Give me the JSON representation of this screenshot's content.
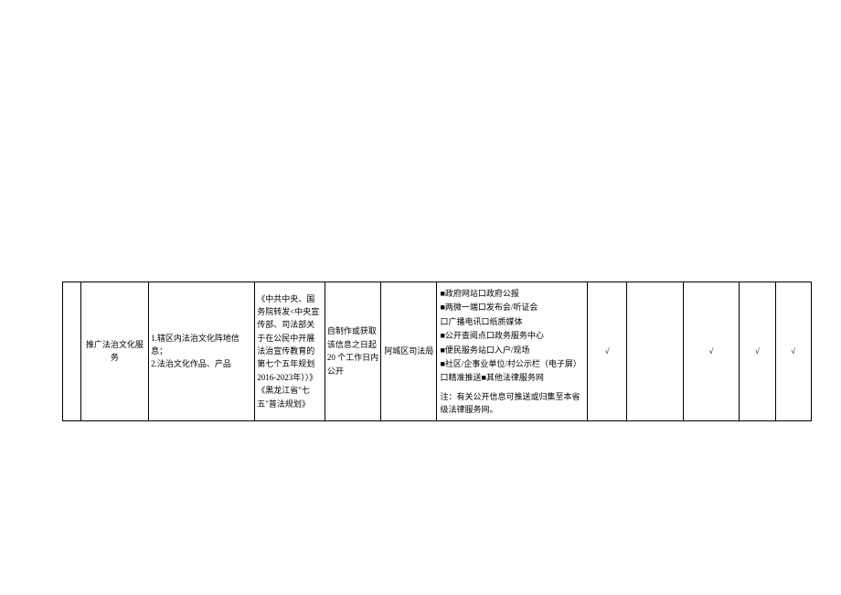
{
  "row": {
    "col0": "",
    "col1": "推广法治文化服务",
    "col2": "1.辖区内法治文化阵地信息；\n2.法治文化作品、产品",
    "col3": "《中共中央、国务院转发<中央宣传部、司法部关于在公民中开展法治宣传教育的第七个五年规划2016-2023年）〉》\n《黑龙江省\"七五\"普法规划》",
    "col4": "自制作或获取该信息之日起 20 个工作日内公开",
    "col5": "阿城区司法局",
    "channels": {
      "l1": "■政府网站口政府公报",
      "l2": "■两微一端口发布会/听证会",
      "l3": "口广播电讯口纸质媒体",
      "l4": "■公开查阅点口政务服务中心",
      "l5": "■便民服务站口入户/现场",
      "l6": "■社区/企事业单位/村公示栏（电子屏）",
      "l7": "口精准推送■其他法律服务网",
      "note": "注：有关公开信息可推送或归集至本省级法律服务网。"
    },
    "col7": "√",
    "col8": "",
    "col9": "√",
    "col10": "√",
    "col11": "√"
  }
}
